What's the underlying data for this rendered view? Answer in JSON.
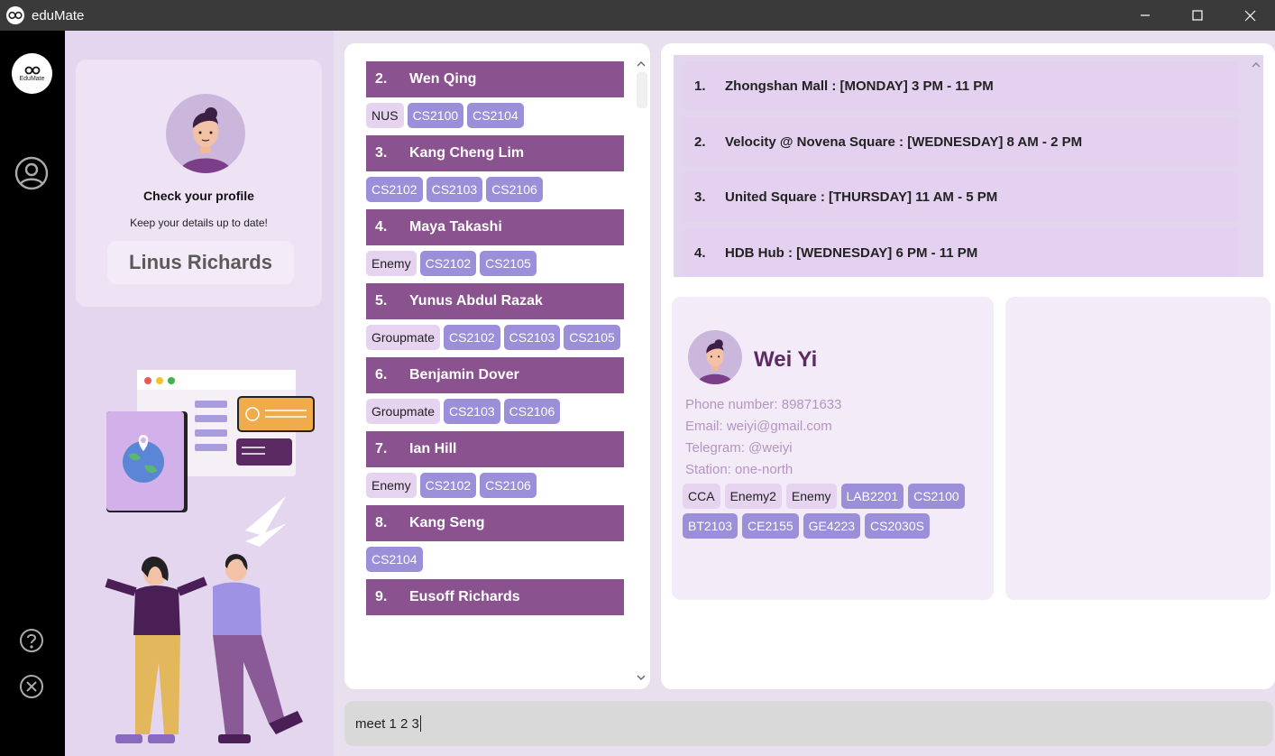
{
  "window": {
    "title": "eduMate"
  },
  "sidebar": {
    "logo_text": "EduMate"
  },
  "profile": {
    "heading": "Check your profile",
    "subtitle": "Keep your details up to date!",
    "name": "Linus Richards"
  },
  "contacts": [
    {
      "index": "2.",
      "name": "Wen Qing",
      "tags": [
        {
          "label": "NUS",
          "kind": "grp"
        },
        {
          "label": "CS2100",
          "kind": "mod"
        },
        {
          "label": "CS2104",
          "kind": "mod"
        }
      ]
    },
    {
      "index": "3.",
      "name": "Kang Cheng Lim",
      "tags": [
        {
          "label": "CS2102",
          "kind": "mod"
        },
        {
          "label": "CS2103",
          "kind": "mod"
        },
        {
          "label": "CS2106",
          "kind": "mod"
        }
      ]
    },
    {
      "index": "4.",
      "name": "Maya Takashi",
      "tags": [
        {
          "label": "Enemy",
          "kind": "grp"
        },
        {
          "label": "CS2102",
          "kind": "mod"
        },
        {
          "label": "CS2105",
          "kind": "mod"
        }
      ]
    },
    {
      "index": "5.",
      "name": "Yunus Abdul Razak",
      "tags": [
        {
          "label": "Groupmate",
          "kind": "grp"
        },
        {
          "label": "CS2102",
          "kind": "mod"
        },
        {
          "label": "CS2103",
          "kind": "mod"
        },
        {
          "label": "CS2105",
          "kind": "mod"
        }
      ]
    },
    {
      "index": "6.",
      "name": "Benjamin Dover",
      "tags": [
        {
          "label": "Groupmate",
          "kind": "grp"
        },
        {
          "label": "CS2103",
          "kind": "mod"
        },
        {
          "label": "CS2106",
          "kind": "mod"
        }
      ]
    },
    {
      "index": "7.",
      "name": "Ian Hill",
      "tags": [
        {
          "label": "Enemy",
          "kind": "grp"
        },
        {
          "label": "CS2102",
          "kind": "mod"
        },
        {
          "label": "CS2106",
          "kind": "mod"
        }
      ]
    },
    {
      "index": "8.",
      "name": "Kang Seng",
      "tags": [
        {
          "label": "CS2104",
          "kind": "mod"
        }
      ]
    },
    {
      "index": "9.",
      "name": "Eusoff Richards",
      "tags": []
    }
  ],
  "meetups": [
    {
      "index": "1.",
      "text": "Zhongshan Mall : [MONDAY] 3 PM - 11 PM"
    },
    {
      "index": "2.",
      "text": "Velocity @ Novena Square : [WEDNESDAY] 8 AM - 2 PM"
    },
    {
      "index": "3.",
      "text": "United Square : [THURSDAY] 11 AM - 5 PM"
    },
    {
      "index": "4.",
      "text": "HDB Hub : [WEDNESDAY] 6 PM - 11 PM"
    }
  ],
  "detail": {
    "name": "Wei Yi",
    "phone": "Phone number: 89871633",
    "email": "Email: weiyi@gmail.com",
    "telegram": "Telegram: @weiyi",
    "station": "Station: one-north",
    "tags": [
      {
        "label": "CCA",
        "kind": "grp"
      },
      {
        "label": "Enemy2",
        "kind": "grp"
      },
      {
        "label": "Enemy",
        "kind": "grp"
      },
      {
        "label": "LAB2201",
        "kind": "mod"
      },
      {
        "label": "CS2100",
        "kind": "mod"
      },
      {
        "label": "BT2103",
        "kind": "mod"
      },
      {
        "label": "CE2155",
        "kind": "mod"
      },
      {
        "label": "GE4223",
        "kind": "mod"
      },
      {
        "label": "CS2030S",
        "kind": "mod"
      }
    ]
  },
  "command": {
    "value": "meet 1 2 3"
  }
}
